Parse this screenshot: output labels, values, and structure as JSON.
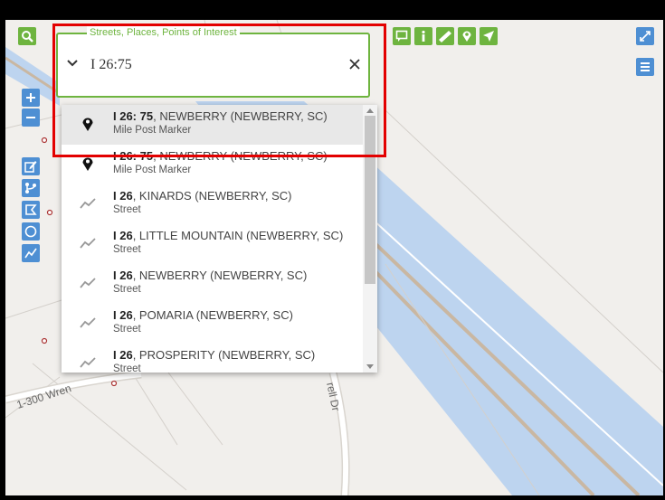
{
  "search": {
    "legend": "Streets, Places, Points of Interest",
    "value": "I 26:75"
  },
  "suggestions": [
    {
      "bold": "I 26: 75",
      "rest": ", NEWBERRY (NEWBERRY, SC)",
      "type": "Mile Post Marker",
      "icon": "map-marker-icon",
      "selected": true
    },
    {
      "bold": "I 26: 75",
      "rest": ", NEWBERRY (NEWBERRY, SC)",
      "type": "Mile Post Marker",
      "icon": "map-marker-icon",
      "selected": false
    },
    {
      "bold": "I 26",
      "rest": ", KINARDS (NEWBERRY, SC)",
      "type": "Street",
      "icon": "street-line-icon",
      "selected": false
    },
    {
      "bold": "I 26",
      "rest": ", LITTLE MOUNTAIN (NEWBERRY, SC)",
      "type": "Street",
      "icon": "street-line-icon",
      "selected": false
    },
    {
      "bold": "I 26",
      "rest": ", NEWBERRY (NEWBERRY, SC)",
      "type": "Street",
      "icon": "street-line-icon",
      "selected": false
    },
    {
      "bold": "I 26",
      "rest": ", POMARIA (NEWBERRY, SC)",
      "type": "Street",
      "icon": "street-line-icon",
      "selected": false
    },
    {
      "bold": "I 26",
      "rest": ", PROSPERITY (NEWBERRY, SC)",
      "type": "Street",
      "icon": "street-line-icon",
      "selected": false
    }
  ],
  "map_labels": {
    "street_1": "1-300 Wren",
    "street_2": "rell Dr"
  },
  "toolbar_icons": [
    "search-icon",
    "comment-icon",
    "info-icon",
    "measure-icon",
    "location-pin-icon",
    "navigate-arrow-icon",
    "expand-icon",
    "layers-menu-icon",
    "zoom-in-icon",
    "zoom-out-icon",
    "edit-icon",
    "route-icon",
    "polygon-icon",
    "circle-icon",
    "line-icon"
  ],
  "colors": {
    "accent_green": "#6eb43f",
    "tool_blue": "#4e8fd3",
    "highlight_red": "#e30000",
    "highway_blue": "#bdd4ef"
  }
}
